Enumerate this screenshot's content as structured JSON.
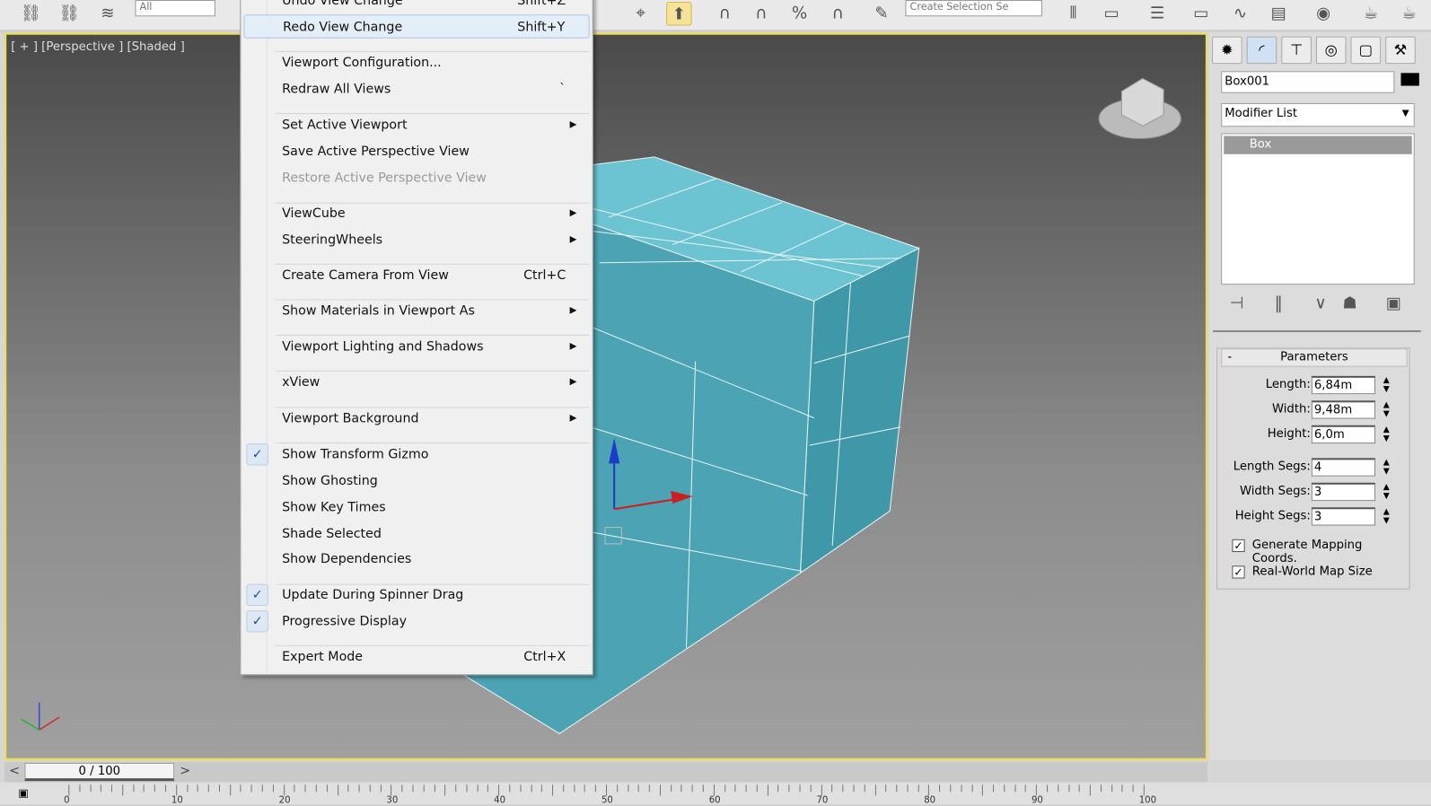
{
  "toolbar": {
    "selection_filter": "All",
    "named_selection_placeholder": "Create Selection Se"
  },
  "viewport": {
    "label": "[ + ] [Perspective ] [Shaded ]",
    "border_color": "#f0e040",
    "object_color": "#5fb8c8"
  },
  "menu": {
    "items": [
      {
        "label": "Undo View Change",
        "shortcut": "Shift+Z"
      },
      {
        "label": "Redo View Change",
        "shortcut": "Shift+Y",
        "highlighted": true
      },
      {
        "label": "Viewport Configuration..."
      },
      {
        "label": "Redraw All Views",
        "shortcut": "`"
      },
      {
        "label": "Set Active Viewport",
        "submenu": true
      },
      {
        "label": "Save Active Perspective View"
      },
      {
        "label": "Restore Active Perspective View",
        "disabled": true
      },
      {
        "label": "ViewCube",
        "submenu": true
      },
      {
        "label": "SteeringWheels",
        "submenu": true
      },
      {
        "label": "Create Camera From View",
        "shortcut": "Ctrl+C"
      },
      {
        "label": "Show Materials in Viewport As",
        "submenu": true
      },
      {
        "label": "Viewport Lighting and Shadows",
        "submenu": true
      },
      {
        "label": "xView",
        "submenu": true
      },
      {
        "label": "Viewport Background",
        "submenu": true
      },
      {
        "label": "Show Transform Gizmo",
        "checked": true
      },
      {
        "label": "Show Ghosting"
      },
      {
        "label": "Show Key Times"
      },
      {
        "label": "Shade Selected"
      },
      {
        "label": "Show Dependencies"
      },
      {
        "label": "Update During Spinner Drag",
        "checked": true
      },
      {
        "label": "Progressive Display",
        "checked": true
      },
      {
        "label": "Expert Mode",
        "shortcut": "Ctrl+X"
      }
    ]
  },
  "panel": {
    "object_name": "Box001",
    "object_color": "#000000",
    "modifier_list": "Modifier List",
    "stack": [
      "Box"
    ],
    "rollout_toggle": "-",
    "rollout_title": "Parameters",
    "params": [
      {
        "label": "Length:",
        "value": "6,84m"
      },
      {
        "label": "Width:",
        "value": "9,48m"
      },
      {
        "label": "Height:",
        "value": "6,0m"
      },
      {
        "label": "Length Segs:",
        "value": "4"
      },
      {
        "label": "Width Segs:",
        "value": "3"
      },
      {
        "label": "Height Segs:",
        "value": "3"
      }
    ],
    "checkboxes": [
      {
        "label": "Generate Mapping Coords.",
        "checked": true
      },
      {
        "label": "Real-World Map Size",
        "checked": true
      }
    ]
  },
  "timeline": {
    "frame": "0 / 100",
    "prev": "<",
    "next": ">",
    "ticks": [
      "0",
      "10",
      "20",
      "30",
      "40",
      "50",
      "60",
      "70",
      "80",
      "90",
      "100"
    ]
  }
}
